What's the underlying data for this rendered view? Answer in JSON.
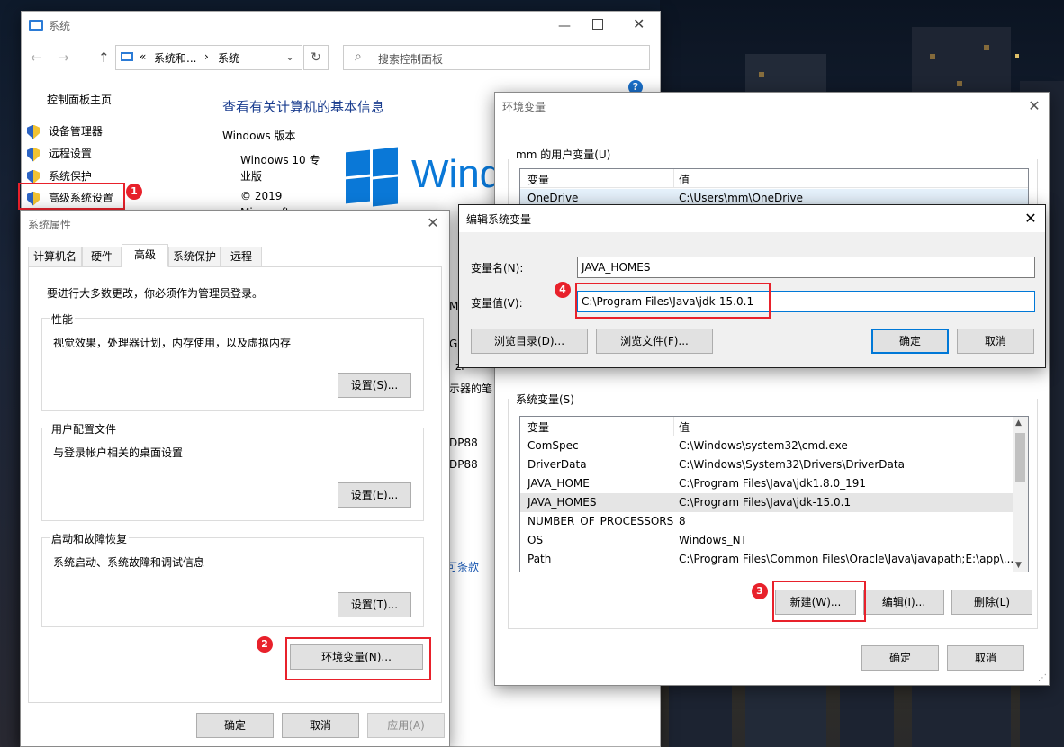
{
  "system_window": {
    "title": "系统",
    "breadcrumb": [
      "«",
      "系统和...",
      "›",
      "系统"
    ],
    "search_placeholder": "搜索控制面板",
    "help": "?",
    "sidebar_home": "控制面板主页",
    "sidebar_items": [
      "设备管理器",
      "远程设置",
      "系统保护",
      "高级系统设置"
    ],
    "heading": "查看有关计算机的基本信息",
    "windows_version_label": "Windows 版本",
    "edition_line1": "Windows 10 专",
    "edition_line2": "业版",
    "copyright_line1": "© 2019",
    "copyright_line2": "Microsoft",
    "brand_text": "Windo",
    "peek_texts": [
      "M",
      "GE",
      "zi",
      "示器的笔",
      "DP88",
      "DP88",
      "可条款"
    ]
  },
  "sysprops": {
    "title": "系统属性",
    "tabs": [
      "计算机名",
      "硬件",
      "高级",
      "系统保护",
      "远程"
    ],
    "active_tab": "高级",
    "admin_note": "要进行大多数更改，你必须作为管理员登录。",
    "performance": {
      "label": "性能",
      "desc": "视觉效果，处理器计划，内存使用，以及虚拟内存",
      "button": "设置(S)..."
    },
    "profile": {
      "label": "用户配置文件",
      "desc": "与登录帐户相关的桌面设置",
      "button": "设置(E)..."
    },
    "startup": {
      "label": "启动和故障恢复",
      "desc": "系统启动、系统故障和调试信息",
      "button": "设置(T)..."
    },
    "env_button": "环境变量(N)...",
    "ok": "确定",
    "cancel": "取消",
    "apply": "应用(A)"
  },
  "envvars": {
    "title": "环境变量",
    "user_group": "mm 的用户变量(U)",
    "col_var": "变量",
    "col_val": "值",
    "user_rows": [
      {
        "var": "OneDrive",
        "val": "C:\\Users\\mm\\OneDrive"
      }
    ],
    "system_group": "系统变量(S)",
    "system_rows": [
      {
        "var": "ComSpec",
        "val": "C:\\Windows\\system32\\cmd.exe"
      },
      {
        "var": "DriverData",
        "val": "C:\\Windows\\System32\\Drivers\\DriverData"
      },
      {
        "var": "JAVA_HOME",
        "val": "C:\\Program Files\\Java\\jdk1.8.0_191"
      },
      {
        "var": "JAVA_HOMES",
        "val": "C:\\Program Files\\Java\\jdk-15.0.1"
      },
      {
        "var": "NUMBER_OF_PROCESSORS",
        "val": "8"
      },
      {
        "var": "OS",
        "val": "Windows_NT"
      },
      {
        "var": "Path",
        "val": "C:\\Program Files\\Common Files\\Oracle\\Java\\javapath;E:\\app\\..."
      }
    ],
    "new_button": "新建(W)...",
    "edit_button": "编辑(I)...",
    "delete_button": "删除(L)",
    "ok": "确定",
    "cancel": "取消"
  },
  "editdlg": {
    "title": "编辑系统变量",
    "name_label": "变量名(N):",
    "name_value": "JAVA_HOMES",
    "value_label": "变量值(V):",
    "value_value": "C:\\Program Files\\Java\\jdk-15.0.1",
    "browse_dir": "浏览目录(D)...",
    "browse_file": "浏览文件(F)...",
    "ok": "确定",
    "cancel": "取消"
  },
  "badges": [
    "1",
    "2",
    "3",
    "4"
  ],
  "colors": {
    "accent": "#0078d7",
    "annotation_red": "#e8212b",
    "link": "#1a57b0"
  }
}
